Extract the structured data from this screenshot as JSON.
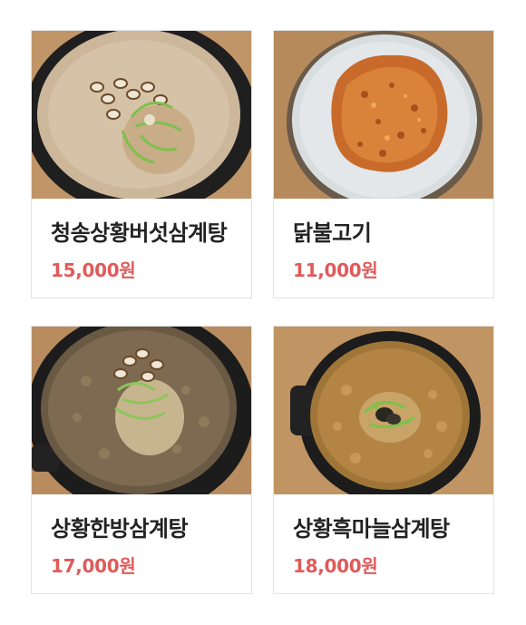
{
  "menu": {
    "items": [
      {
        "name": "청송상황버섯삼계탕",
        "price": "15,000원",
        "photo_icon": "soup-bowl-photo"
      },
      {
        "name": "닭불고기",
        "price": "11,000원",
        "photo_icon": "grilled-chicken-plate-photo"
      },
      {
        "name": "상황한방삼계탕",
        "price": "17,000원",
        "photo_icon": "soup-pot-photo"
      },
      {
        "name": "상황흑마늘삼계탕",
        "price": "18,000원",
        "photo_icon": "soup-pot-photo"
      }
    ]
  },
  "colors": {
    "price": "#e05a5a",
    "name": "#222222",
    "border": "#e3e3e3"
  }
}
